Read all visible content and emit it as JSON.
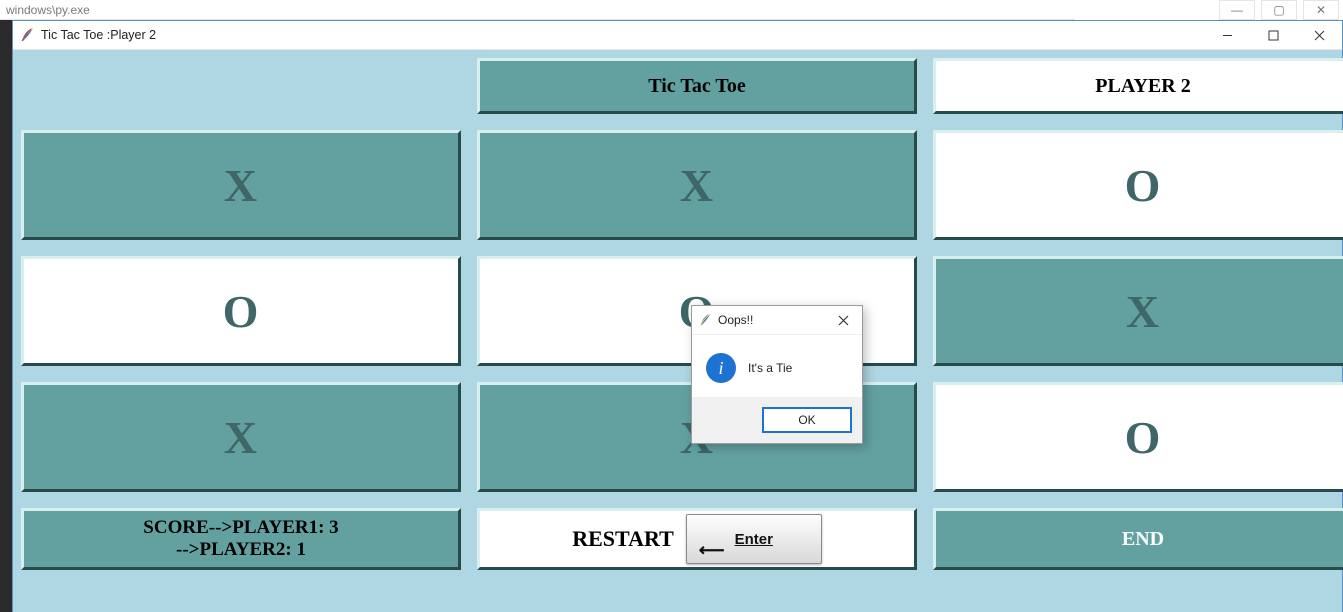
{
  "back_window": {
    "title_fragment": "windows\\py.exe"
  },
  "window": {
    "title": "Tic Tac Toe :Player 2"
  },
  "header": {
    "title_label": "Tic Tac Toe",
    "player_label": "PLAYER 2"
  },
  "board": {
    "cells": [
      [
        "X",
        "X",
        "O"
      ],
      [
        "O",
        "O",
        "X"
      ],
      [
        "X",
        "X",
        "O"
      ]
    ],
    "teal_mask": [
      [
        true,
        true,
        false
      ],
      [
        false,
        false,
        true
      ],
      [
        true,
        true,
        false
      ]
    ]
  },
  "bottom": {
    "score_line1": "SCORE-->PLAYER1: 3",
    "score_line2": "-->PLAYER2: 1",
    "restart_label": "RESTART",
    "enter_label": "Enter",
    "end_label": "END"
  },
  "dialog": {
    "title": "Oops!!",
    "message": "It's a Tie",
    "ok": "OK",
    "icon": "info-icon"
  },
  "colors": {
    "client_bg": "#aed7e3",
    "teal": "#63a1a1",
    "teal_fg": "#3f6767",
    "dialog_accent": "#1e73d2"
  }
}
